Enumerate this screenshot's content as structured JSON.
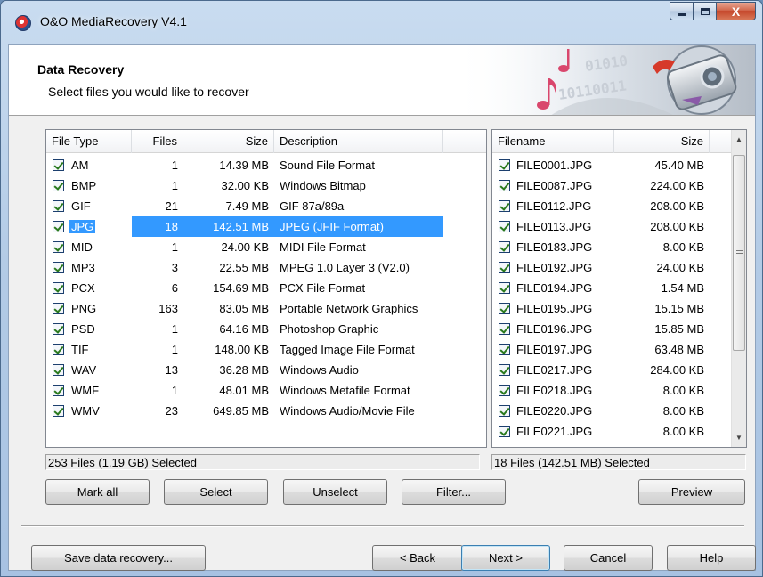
{
  "window": {
    "title": "O&O MediaRecovery V4.1",
    "close_glyph": "X"
  },
  "header": {
    "title": "Data Recovery",
    "subtitle": "Select files you would like to recover"
  },
  "file_types": {
    "columns": [
      "File Type",
      "Files",
      "Size",
      "Description"
    ],
    "rows": [
      {
        "type": "AM",
        "files": "1",
        "size": "14.39 MB",
        "desc": "Sound File Format",
        "checked": true
      },
      {
        "type": "BMP",
        "files": "1",
        "size": "32.00 KB",
        "desc": "Windows Bitmap",
        "checked": true
      },
      {
        "type": "GIF",
        "files": "21",
        "size": "7.49 MB",
        "desc": "GIF 87a/89a",
        "checked": true
      },
      {
        "type": "JPG",
        "files": "18",
        "size": "142.51 MB",
        "desc": "JPEG (JFIF Format)",
        "checked": true,
        "selected": true
      },
      {
        "type": "MID",
        "files": "1",
        "size": "24.00 KB",
        "desc": "MIDI File Format",
        "checked": true
      },
      {
        "type": "MP3",
        "files": "3",
        "size": "22.55 MB",
        "desc": "MPEG 1.0 Layer 3 (V2.0)",
        "checked": true
      },
      {
        "type": "PCX",
        "files": "6",
        "size": "154.69 MB",
        "desc": "PCX File Format",
        "checked": true
      },
      {
        "type": "PNG",
        "files": "163",
        "size": "83.05 MB",
        "desc": "Portable Network Graphics",
        "checked": true
      },
      {
        "type": "PSD",
        "files": "1",
        "size": "64.16 MB",
        "desc": "Photoshop Graphic",
        "checked": true
      },
      {
        "type": "TIF",
        "files": "1",
        "size": "148.00 KB",
        "desc": "Tagged Image File Format",
        "checked": true
      },
      {
        "type": "WAV",
        "files": "13",
        "size": "36.28 MB",
        "desc": "Windows Audio",
        "checked": true
      },
      {
        "type": "WMF",
        "files": "1",
        "size": "48.01 MB",
        "desc": "Windows Metafile Format",
        "checked": true
      },
      {
        "type": "WMV",
        "files": "23",
        "size": "649.85 MB",
        "desc": "Windows Audio/Movie File",
        "checked": true
      }
    ],
    "status": "253 Files (1.19 GB) Selected"
  },
  "files": {
    "columns": [
      "Filename",
      "Size"
    ],
    "rows": [
      {
        "name": "FILE0001.JPG",
        "size": "45.40 MB",
        "checked": true
      },
      {
        "name": "FILE0087.JPG",
        "size": "224.00 KB",
        "checked": true
      },
      {
        "name": "FILE0112.JPG",
        "size": "208.00 KB",
        "checked": true
      },
      {
        "name": "FILE0113.JPG",
        "size": "208.00 KB",
        "checked": true
      },
      {
        "name": "FILE0183.JPG",
        "size": "8.00 KB",
        "checked": true
      },
      {
        "name": "FILE0192.JPG",
        "size": "24.00 KB",
        "checked": true
      },
      {
        "name": "FILE0194.JPG",
        "size": "1.54 MB",
        "checked": true
      },
      {
        "name": "FILE0195.JPG",
        "size": "15.15 MB",
        "checked": true
      },
      {
        "name": "FILE0196.JPG",
        "size": "15.85 MB",
        "checked": true
      },
      {
        "name": "FILE0197.JPG",
        "size": "63.48 MB",
        "checked": true
      },
      {
        "name": "FILE0217.JPG",
        "size": "284.00 KB",
        "checked": true
      },
      {
        "name": "FILE0218.JPG",
        "size": "8.00 KB",
        "checked": true
      },
      {
        "name": "FILE0220.JPG",
        "size": "8.00 KB",
        "checked": true
      },
      {
        "name": "FILE0221.JPG",
        "size": "8.00 KB",
        "checked": true
      }
    ],
    "status": "18 Files (142.51 MB) Selected"
  },
  "buttons": {
    "mark_all": "Mark all",
    "select": "Select",
    "unselect": "Unselect",
    "filter": "Filter...",
    "preview": "Preview",
    "save": "Save data recovery...",
    "back": "< Back",
    "next": "Next >",
    "cancel": "Cancel",
    "help": "Help"
  },
  "icons": {
    "app": "o-and-o-logo-icon",
    "banner": "camera-and-music-note-banner",
    "checkbox": "checkmark"
  }
}
